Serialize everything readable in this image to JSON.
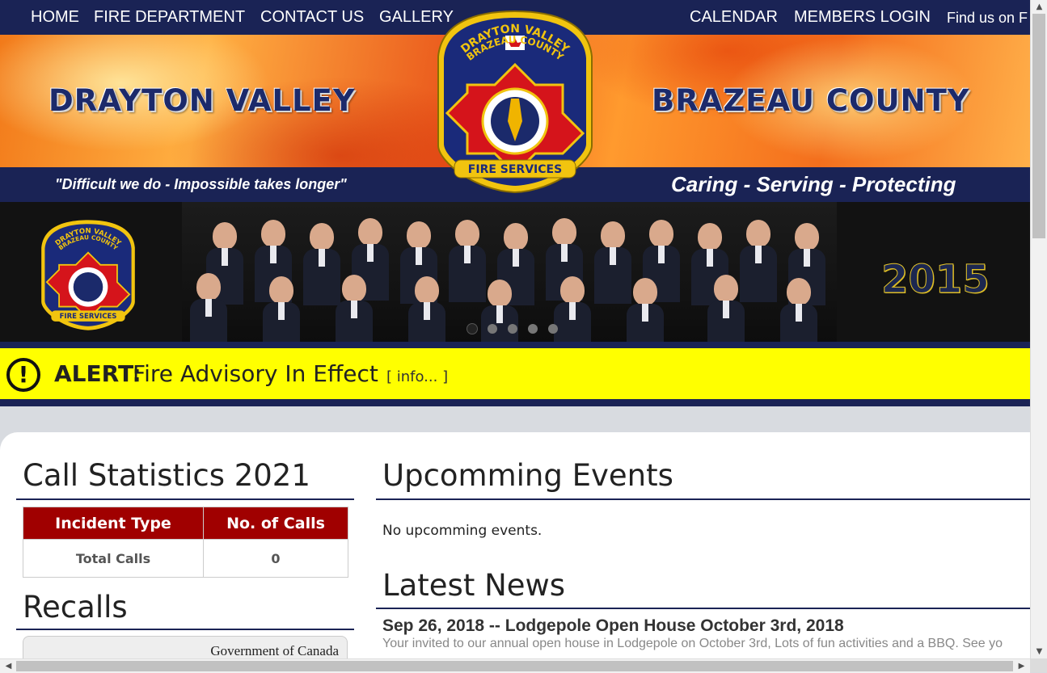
{
  "nav": {
    "home": "HOME",
    "fire_department": "FIRE DEPARTMENT",
    "contact": "CONTACT US",
    "gallery": "GALLERY",
    "calendar": "CALENDAR",
    "members": "MEMBERS LOGIN",
    "find_us": "Find us on F"
  },
  "banner": {
    "left_title": "DRAYTON VALLEY",
    "right_title": "BRAZEAU COUNTY",
    "motto_left": "\"Difficult we do - Impossible takes longer\"",
    "motto_right": "Caring - Serving - Protecting",
    "badge_top": "DRAYTON VALLEY",
    "badge_top2": "BRAZEAU COUNTY",
    "badge_bottom": "FIRE SERVICES"
  },
  "slider": {
    "year": "2015",
    "badge_top": "DRAYTON VALLEY",
    "badge_top2": "BRAZEAU COUNTY",
    "badge_bottom": "FIRE SERVICES",
    "active_slide": 1,
    "slide_count": 5
  },
  "alert": {
    "label": "ALERT:",
    "message": "Fire Advisory In Effect",
    "info": "[ info... ]",
    "icon": "exclamation-icon"
  },
  "stats": {
    "title": "Call Statistics 2021",
    "headers": [
      "Incident Type",
      "No. of Calls"
    ],
    "rows": [
      [
        "Total Calls",
        "0"
      ]
    ]
  },
  "recalls": {
    "title": "Recalls",
    "source": "Government of Canada"
  },
  "events": {
    "title": "Upcomming Events",
    "empty": "No upcomming events."
  },
  "news": {
    "title": "Latest News",
    "items": [
      {
        "headline": "Sep 26, 2018 -- Lodgepole Open House October 3rd, 2018",
        "body": "Your invited to our annual open house in Lodgepole on October 3rd, Lots of fun activities and a BBQ.  See yo"
      }
    ]
  },
  "colors": {
    "navy": "#1a2355",
    "alert_yellow": "#ffff00",
    "table_red": "#a00000"
  }
}
